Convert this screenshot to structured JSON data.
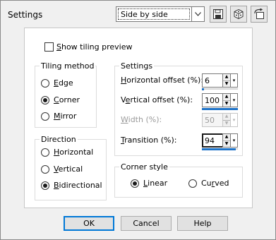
{
  "window": {
    "title": "Settings"
  },
  "preset": {
    "value": "Side by side"
  },
  "toolbar": {
    "save_icon": "save-icon",
    "gallery_icon": "cube-icon",
    "reset_icon": "reset-icon"
  },
  "main": {
    "show_preview": {
      "label": "Show tiling preview",
      "mnemonic": "S",
      "rest": "how tiling preview",
      "checked": false
    },
    "tiling_method": {
      "label": "Tiling method",
      "options": [
        {
          "label": "Edge",
          "mnemonic": "E",
          "rest": "dge",
          "selected": false
        },
        {
          "label": "Corner",
          "mnemonic": "C",
          "rest": "orner",
          "selected": true
        },
        {
          "label": "Mirror",
          "mnemonic": "M",
          "rest": "irror",
          "selected": false
        }
      ]
    },
    "direction": {
      "label": "Direction",
      "options": [
        {
          "label": "Horizontal",
          "mnemonic": "H",
          "rest": "orizontal",
          "selected": false
        },
        {
          "label": "Vertical",
          "mnemonic": "V",
          "rest": "ertical",
          "selected": false
        },
        {
          "label": "Bidirectional",
          "mnemonic": "B",
          "rest": "idirectional",
          "selected": true
        }
      ]
    },
    "settings": {
      "label": "Settings",
      "fields": [
        {
          "label": "Horizontal offset (%):",
          "mnemonic": "H",
          "pre": "",
          "rest": "orizontal offset (%):",
          "value": "6",
          "enabled": true,
          "focused": false,
          "level": 0.06
        },
        {
          "label": "Vertical offset (%):",
          "mnemonic": "e",
          "pre": "V",
          "rest": "rtical offset (%):",
          "value": "100",
          "enabled": true,
          "focused": false,
          "level": 1.0
        },
        {
          "label": "Width (%):",
          "mnemonic": "W",
          "pre": "",
          "rest": "idth (%):",
          "value": "50",
          "enabled": false,
          "focused": false,
          "level": 0.5
        },
        {
          "label": "Transition (%):",
          "mnemonic": "T",
          "pre": "",
          "rest": "ransition (%):",
          "value": "94",
          "enabled": true,
          "focused": true,
          "level": 0.94
        }
      ]
    },
    "corner_style": {
      "label": "Corner style",
      "options": [
        {
          "label": "Linear",
          "mnemonic": "L",
          "rest": "inear",
          "selected": true
        },
        {
          "label": "Curved",
          "mnemonic": "r",
          "pre": "Cu",
          "rest": "ved",
          "selected": false
        }
      ]
    }
  },
  "buttons": {
    "ok": "OK",
    "cancel": "Cancel",
    "help": "Help"
  },
  "colors": {
    "accent": "#1e73c8",
    "focus": "#0078d7",
    "panel": "#ffffff",
    "chrome": "#f0f0f0"
  }
}
